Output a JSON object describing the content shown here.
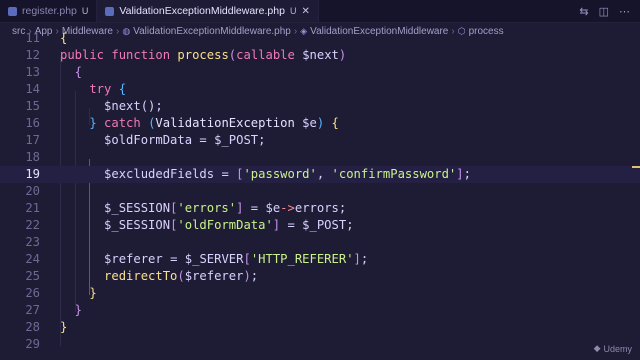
{
  "tabs": [
    {
      "label": "register.php",
      "status": "U",
      "active": false
    },
    {
      "label": "ValidationExceptionMiddleware.php",
      "status": "U",
      "active": true
    }
  ],
  "breadcrumb": [
    "src",
    "App",
    "Middleware",
    "ValidationExceptionMiddleware.php",
    "ValidationExceptionMiddleware",
    "process"
  ],
  "lines": [
    {
      "num": "11",
      "tokens": [
        {
          "t": "{",
          "c": "t-br"
        }
      ]
    },
    {
      "num": "12",
      "tokens": [
        {
          "t": "public",
          "c": "t-kw"
        },
        {
          "t": " ",
          "c": "t-plain"
        },
        {
          "t": "function",
          "c": "t-kw"
        },
        {
          "t": " ",
          "c": "t-plain"
        },
        {
          "t": "process",
          "c": "t-fn"
        },
        {
          "t": "(",
          "c": "t-br2"
        },
        {
          "t": "callable",
          "c": "t-kw"
        },
        {
          "t": " ",
          "c": "t-plain"
        },
        {
          "t": "$next",
          "c": "t-var"
        },
        {
          "t": ")",
          "c": "t-br2"
        }
      ]
    },
    {
      "num": "13",
      "tokens": [
        {
          "t": "  {",
          "c": "t-br2"
        }
      ]
    },
    {
      "num": "14",
      "tokens": [
        {
          "t": "    try",
          "c": "t-kw"
        },
        {
          "t": " ",
          "c": "t-plain"
        },
        {
          "t": "{",
          "c": "t-br3"
        }
      ]
    },
    {
      "num": "15",
      "tokens": [
        {
          "t": "      $next",
          "c": "t-var"
        },
        {
          "t": "();",
          "c": "t-punc"
        }
      ]
    },
    {
      "num": "16",
      "tokens": [
        {
          "t": "    }",
          "c": "t-br3"
        },
        {
          "t": " ",
          "c": "t-plain"
        },
        {
          "t": "catch",
          "c": "t-kw"
        },
        {
          "t": " ",
          "c": "t-plain"
        },
        {
          "t": "(",
          "c": "t-br3"
        },
        {
          "t": "ValidationException",
          "c": "t-type"
        },
        {
          "t": " ",
          "c": "t-plain"
        },
        {
          "t": "$e",
          "c": "t-var"
        },
        {
          "t": ")",
          "c": "t-br3"
        },
        {
          "t": " ",
          "c": "t-plain"
        },
        {
          "t": "{",
          "c": "t-br"
        }
      ]
    },
    {
      "num": "17",
      "tokens": [
        {
          "t": "      $oldFormData",
          "c": "t-var"
        },
        {
          "t": " ",
          "c": "t-plain"
        },
        {
          "t": "=",
          "c": "t-plain"
        },
        {
          "t": " ",
          "c": "t-plain"
        },
        {
          "t": "$_POST",
          "c": "t-var"
        },
        {
          "t": ";",
          "c": "t-punc"
        }
      ]
    },
    {
      "num": "18",
      "tokens": []
    },
    {
      "num": "19",
      "tokens": [
        {
          "t": "      $excludedFields",
          "c": "t-var"
        },
        {
          "t": " ",
          "c": "t-plain"
        },
        {
          "t": "=",
          "c": "t-plain"
        },
        {
          "t": " ",
          "c": "t-plain"
        },
        {
          "t": "[",
          "c": "t-br2"
        },
        {
          "t": "'password'",
          "c": "t-str"
        },
        {
          "t": ", ",
          "c": "t-punc"
        },
        {
          "t": "'confirmPassword'",
          "c": "t-str"
        },
        {
          "t": "]",
          "c": "t-br2"
        },
        {
          "t": ";",
          "c": "t-punc"
        }
      ]
    },
    {
      "num": "20",
      "tokens": []
    },
    {
      "num": "21",
      "tokens": [
        {
          "t": "      $_SESSION",
          "c": "t-var"
        },
        {
          "t": "[",
          "c": "t-br2"
        },
        {
          "t": "'errors'",
          "c": "t-str"
        },
        {
          "t": "]",
          "c": "t-br2"
        },
        {
          "t": " ",
          "c": "t-plain"
        },
        {
          "t": "=",
          "c": "t-plain"
        },
        {
          "t": " ",
          "c": "t-plain"
        },
        {
          "t": "$e",
          "c": "t-var"
        },
        {
          "t": "->",
          "c": "t-op"
        },
        {
          "t": "errors",
          "c": "t-prop"
        },
        {
          "t": ";",
          "c": "t-punc"
        }
      ]
    },
    {
      "num": "22",
      "tokens": [
        {
          "t": "      $_SESSION",
          "c": "t-var"
        },
        {
          "t": "[",
          "c": "t-br2"
        },
        {
          "t": "'oldFormData'",
          "c": "t-str"
        },
        {
          "t": "]",
          "c": "t-br2"
        },
        {
          "t": " ",
          "c": "t-plain"
        },
        {
          "t": "=",
          "c": "t-plain"
        },
        {
          "t": " ",
          "c": "t-plain"
        },
        {
          "t": "$_POST",
          "c": "t-var"
        },
        {
          "t": ";",
          "c": "t-punc"
        }
      ]
    },
    {
      "num": "23",
      "tokens": []
    },
    {
      "num": "24",
      "tokens": [
        {
          "t": "      $referer",
          "c": "t-var"
        },
        {
          "t": " ",
          "c": "t-plain"
        },
        {
          "t": "=",
          "c": "t-plain"
        },
        {
          "t": " ",
          "c": "t-plain"
        },
        {
          "t": "$_SERVER",
          "c": "t-var"
        },
        {
          "t": "[",
          "c": "t-br2"
        },
        {
          "t": "'HTTP_REFERER'",
          "c": "t-str"
        },
        {
          "t": "]",
          "c": "t-br2"
        },
        {
          "t": ";",
          "c": "t-punc"
        }
      ]
    },
    {
      "num": "25",
      "tokens": [
        {
          "t": "      redirectTo",
          "c": "t-fn"
        },
        {
          "t": "(",
          "c": "t-br2"
        },
        {
          "t": "$referer",
          "c": "t-var"
        },
        {
          "t": ")",
          "c": "t-br2"
        },
        {
          "t": ";",
          "c": "t-punc"
        }
      ]
    },
    {
      "num": "26",
      "tokens": [
        {
          "t": "    }",
          "c": "t-br"
        }
      ]
    },
    {
      "num": "27",
      "tokens": [
        {
          "t": "  }",
          "c": "t-br2"
        }
      ]
    },
    {
      "num": "28",
      "tokens": [
        {
          "t": "}",
          "c": "t-br"
        }
      ]
    },
    {
      "num": "29",
      "tokens": []
    }
  ],
  "active_line": "19",
  "watermark": "Udemy"
}
